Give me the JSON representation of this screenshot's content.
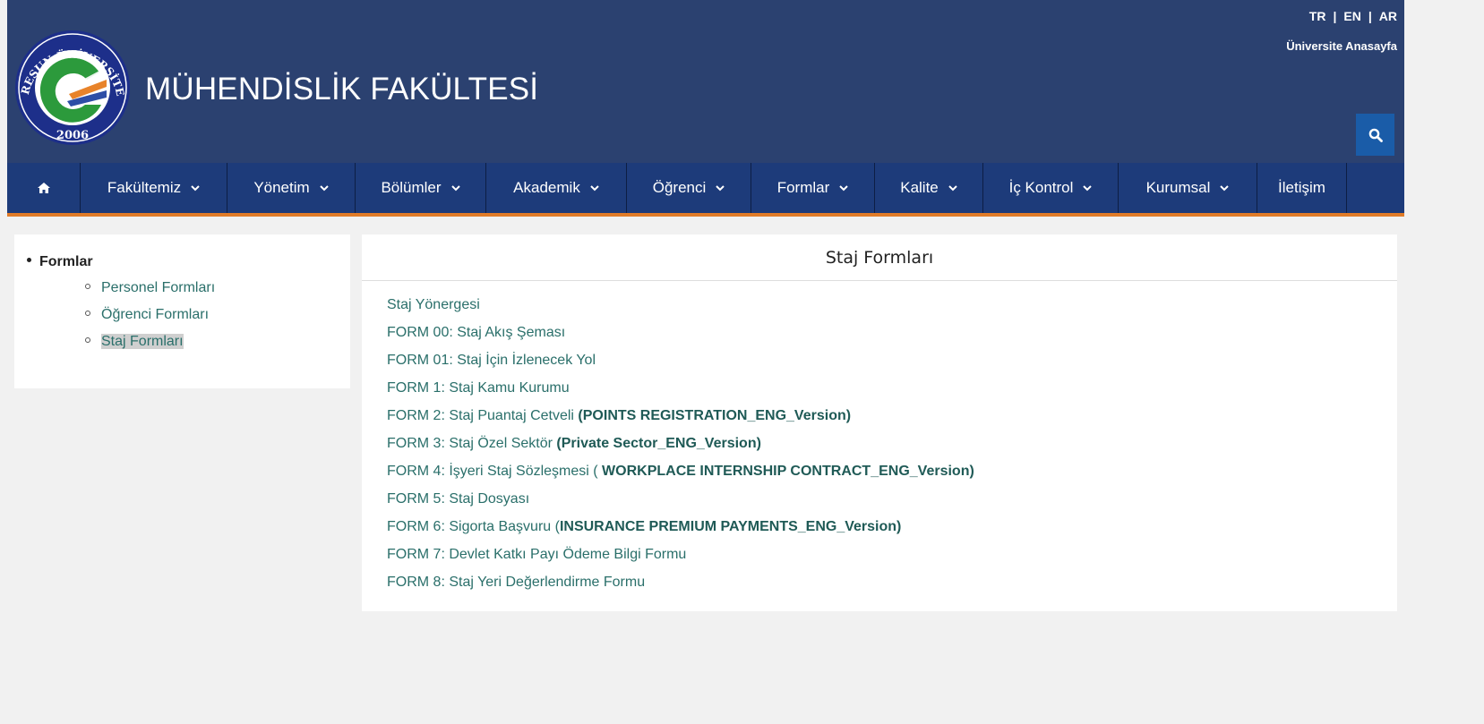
{
  "header": {
    "title": "MÜHENDİSLİK FAKÜLTESİ",
    "logo": {
      "top_text": "GİRESUN ÜNİVERSİTESİ",
      "year": "2006"
    },
    "languages": [
      "TR",
      "EN",
      "AR"
    ],
    "lang_separator": "|",
    "home_link": "Üniversite Anasayfa",
    "search_icon": "search-icon"
  },
  "nav": {
    "home_icon": "home-icon",
    "items": [
      {
        "label": "Fakültemiz",
        "dropdown": true
      },
      {
        "label": "Yönetim",
        "dropdown": true
      },
      {
        "label": "Bölümler",
        "dropdown": true
      },
      {
        "label": "Akademik",
        "dropdown": true
      },
      {
        "label": "Öğrenci",
        "dropdown": true
      },
      {
        "label": "Formlar",
        "dropdown": true
      },
      {
        "label": "Kalite",
        "dropdown": true
      },
      {
        "label": "İç Kontrol",
        "dropdown": true
      },
      {
        "label": "Kurumsal",
        "dropdown": true
      },
      {
        "label": "İletişim",
        "dropdown": false
      }
    ]
  },
  "sidebar": {
    "title": "Formlar",
    "items": [
      "Personel Formları",
      "Öğrenci Formları",
      "Staj Formları"
    ],
    "active_index": 2
  },
  "main": {
    "title": "Staj Formları",
    "links": [
      {
        "text": "Staj Yönergesi",
        "eng": ""
      },
      {
        "text": "FORM 00: Staj Akış Şeması",
        "eng": ""
      },
      {
        "text": "FORM 01: Staj İçin İzlenecek Yol",
        "eng": ""
      },
      {
        "text": "FORM 1: Staj Kamu Kurumu",
        "eng": ""
      },
      {
        "text": "FORM 2: Staj Puantaj Cetveli ",
        "eng": "(POINTS REGISTRATION_ENG_Version)"
      },
      {
        "text": "FORM 3: Staj Özel Sektör ",
        "eng": "(Private Sector_ENG_Version)"
      },
      {
        "text": "FORM 4: İşyeri Staj Sözleşmesi ( ",
        "eng": "WORKPLACE INTERNSHIP CONTRACT_ENG_Version)"
      },
      {
        "text": "FORM 5: Staj Dosyası",
        "eng": ""
      },
      {
        "text": "FORM 6: Sigorta Başvuru (",
        "eng": "INSURANCE PREMIUM PAYMENTS_ENG_Version)"
      },
      {
        "text": "FORM 7: Devlet Katkı Payı Ödeme Bilgi Formu",
        "eng": ""
      },
      {
        "text": "FORM 8: Staj Yeri Değerlendirme Formu",
        "eng": ""
      }
    ]
  },
  "colors": {
    "header_bg": "#2b4170",
    "nav_bg": "#1d3b7a",
    "nav_border": "#e07b28",
    "link": "#2a6f6a",
    "search_bg": "#1a5ca8"
  }
}
